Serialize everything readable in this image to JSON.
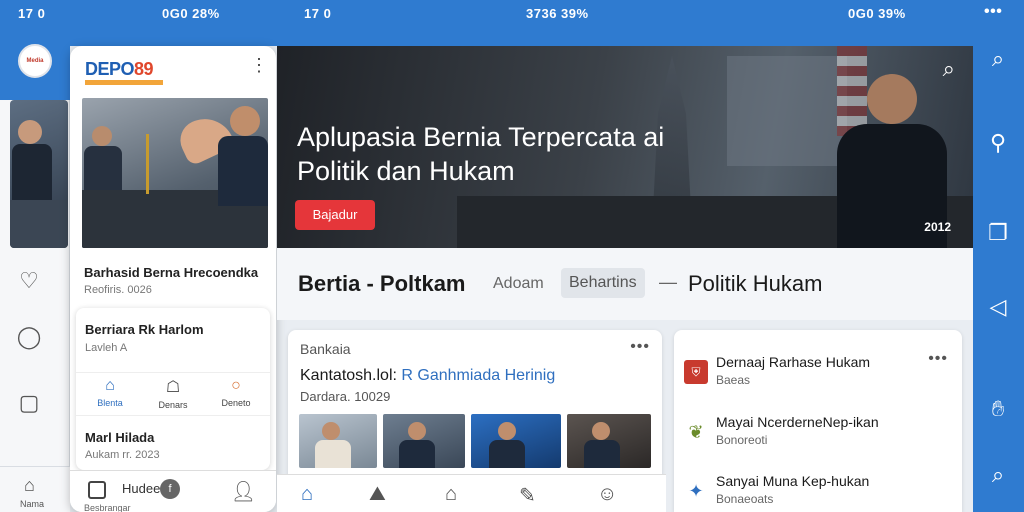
{
  "status": {
    "left_time": "17 0",
    "left_right": "0G0 28%",
    "mid_time": "17 0",
    "mid_right": "3736 39%",
    "right_right": "0G0 39%",
    "dots": "•••"
  },
  "left": {
    "logo_text": "Media",
    "nav_label": "Nama"
  },
  "phone": {
    "logo_main": "DEPO",
    "logo_num": "89",
    "menu_icon": "⋮",
    "title": "Barhasid Berna Hrecoendka",
    "date": "Reofiris. 0026",
    "card": {
      "title": "Berriara Rk Harlom",
      "subtitle": "Lavleh A",
      "nav": [
        {
          "label": "Blenta",
          "icon": "home-icon"
        },
        {
          "label": "Denars",
          "icon": "news-icon"
        },
        {
          "label": "Deneto",
          "icon": "chat-icon"
        }
      ],
      "title2": "Marl Hilada",
      "subtitle2": "Aukam rr. 2023"
    },
    "bottom": {
      "label": "Hudee",
      "sub": "Besbrangar",
      "badge": "f"
    }
  },
  "hero": {
    "title": "Aplupasia Bernia Terpercata ai Politik dan Hukam",
    "button": "Bajadur",
    "count": "2012"
  },
  "heading": {
    "main": "Bertia - Poltkam",
    "tab1": "Adoam",
    "tab2": "Behartins",
    "dash": "—",
    "right": "Politik Hukam"
  },
  "card_a": {
    "label": "Bankaia",
    "title_a": "Kantatosh.lol: ",
    "title_b": "R Ganhmiada Herinig",
    "date": "Dardara. 10029"
  },
  "card_b": {
    "rows": [
      {
        "title": "Dernaaj Rarhase Hukam",
        "sub": "Baeas"
      },
      {
        "title": "Mayai NcerderneNep-ikan",
        "sub": "Bonoreoti"
      },
      {
        "title": "Sanyai Muna Kep-hukan",
        "sub": "Bonaeoats"
      }
    ]
  },
  "colors": {
    "accent": "#2f7bd0",
    "button": "#e5363a",
    "hero_bg": "#2b3037"
  }
}
